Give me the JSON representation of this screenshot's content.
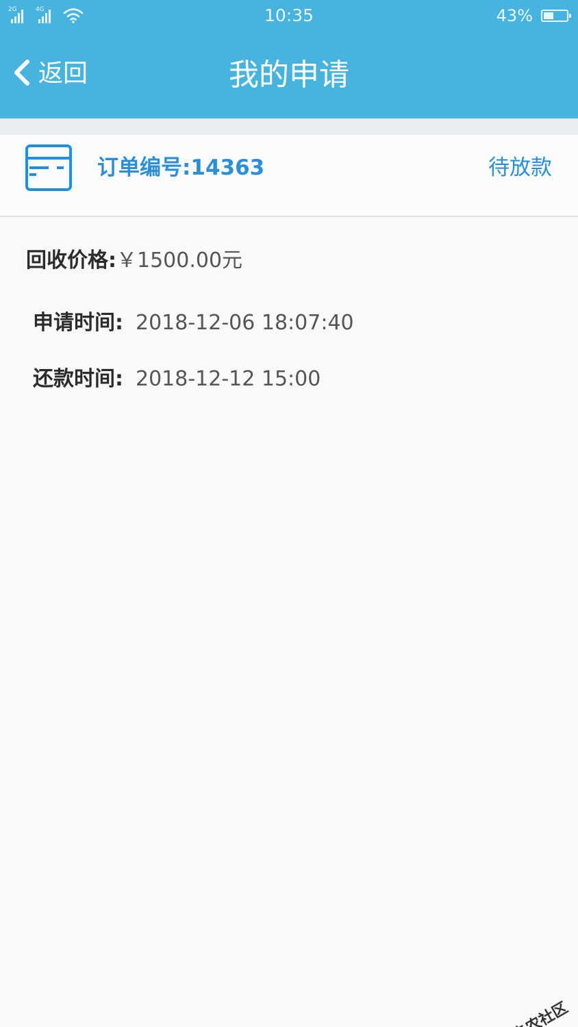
{
  "status_bar": {
    "signal1_label": "2G",
    "signal2_label": "4G",
    "time": "10:35",
    "battery_percent": "43%",
    "battery_level": 0.43
  },
  "nav": {
    "back_label": "返回",
    "title": "我的申请"
  },
  "order": {
    "number_label": "订单编号:14363",
    "status": "待放款"
  },
  "details": {
    "price_key": "回收价格:",
    "price_value": "￥1500.00元",
    "apply_time_key": "申请时间:",
    "apply_time_value": "2018-12-06 18:07:40",
    "repay_time_key": "还款时间:",
    "repay_time_value": "2018-12-12 15:00"
  },
  "watermark": {
    "text": "卡农社区"
  },
  "colors": {
    "header_blue": "#47b3df",
    "accent_blue": "#2a8fd8",
    "background": "#f9f9f9"
  }
}
